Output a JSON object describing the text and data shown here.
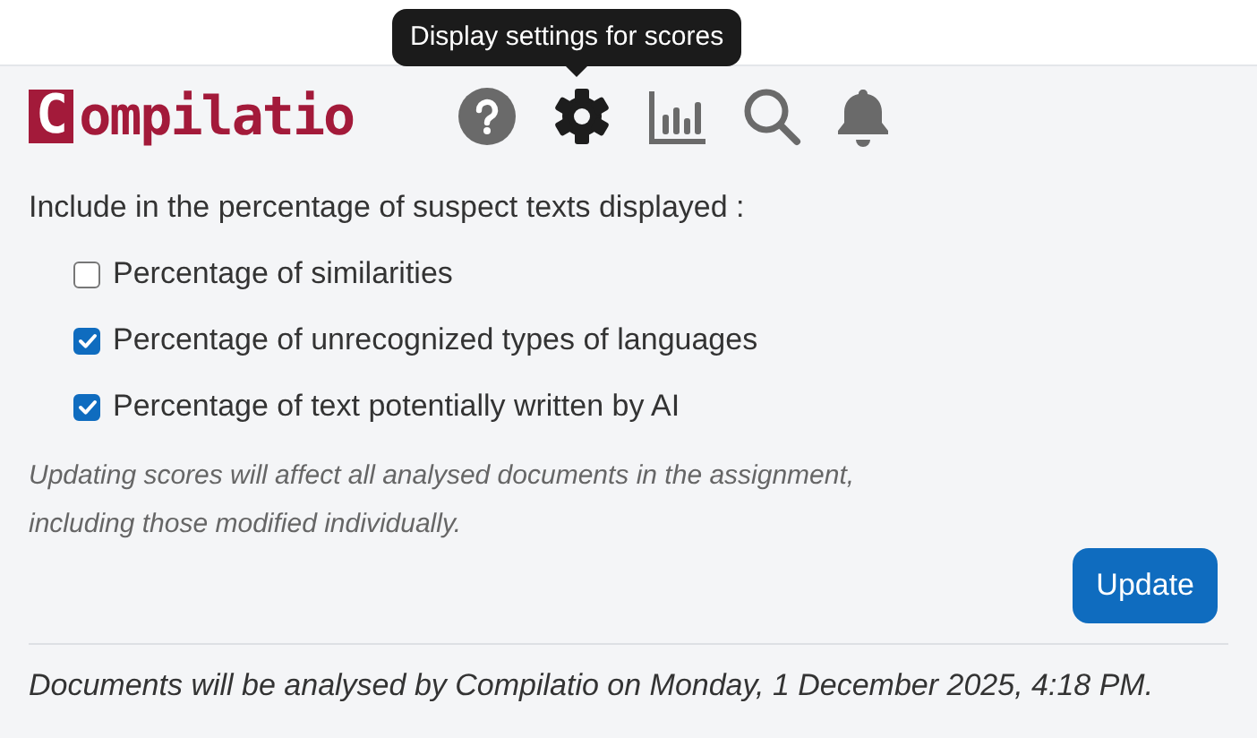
{
  "tooltip": "Display settings for scores",
  "logo": {
    "boxed_letter": "C",
    "rest": "ompilatio"
  },
  "toolbar": [
    {
      "kind": "help"
    },
    {
      "kind": "gear"
    },
    {
      "kind": "chart"
    },
    {
      "kind": "search"
    },
    {
      "kind": "bell"
    }
  ],
  "settings": {
    "heading": "Include in the percentage of suspect texts displayed :",
    "options": [
      {
        "label": "Percentage of similarities",
        "checked": false
      },
      {
        "label": "Percentage of unrecognized types of languages",
        "checked": true
      },
      {
        "label": "Percentage of text potentially written by AI",
        "checked": true
      }
    ],
    "note": [
      "Updating scores will affect all analysed documents in the assignment,",
      "including those modified individually."
    ],
    "button": "Update"
  },
  "footer": "Documents will be analysed by Compilatio on Monday, 1 December 2025, 4:18 PM."
}
